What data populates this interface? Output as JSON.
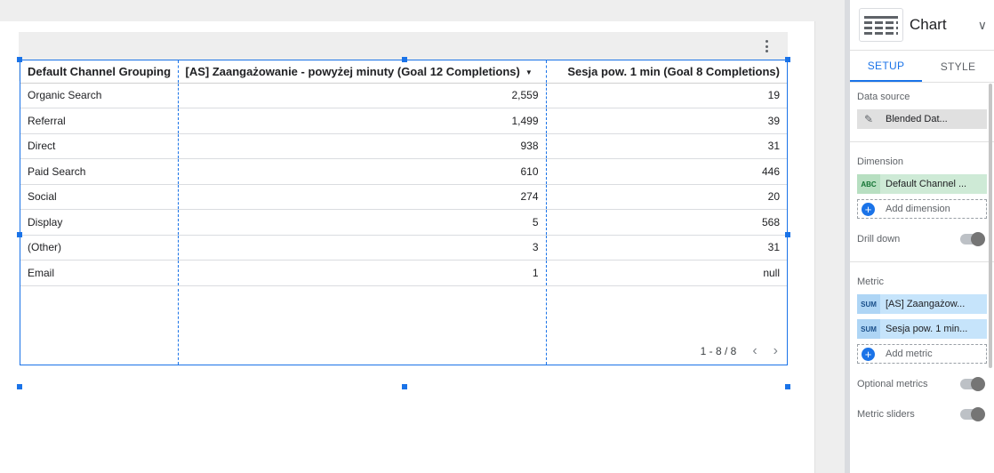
{
  "table": {
    "headers": [
      "Default Channel Grouping",
      "[AS] Zaangażowanie - powyżej minuty (Goal 12 Completions)",
      "Sesja pow. 1 min (Goal 8 Completions)"
    ],
    "rows": [
      [
        "Organic Search",
        "2,559",
        "19"
      ],
      [
        "Referral",
        "1,499",
        "39"
      ],
      [
        "Direct",
        "938",
        "31"
      ],
      [
        "Paid Search",
        "610",
        "446"
      ],
      [
        "Social",
        "274",
        "20"
      ],
      [
        "Display",
        "5",
        "568"
      ],
      [
        "(Other)",
        "3",
        "31"
      ],
      [
        "Email",
        "1",
        "null"
      ]
    ],
    "pager": "1 - 8 / 8",
    "sort_icon": "sort-desc-icon"
  },
  "panel": {
    "title": "Chart",
    "tabs": [
      "SETUP",
      "STYLE"
    ],
    "data_source_label": "Data source",
    "data_source_value": "Blended Dat...",
    "dimension_label": "Dimension",
    "dimension_tag": "ABC",
    "dimension_value": "Default Channel ...",
    "add_dimension": "Add dimension",
    "drill_down": "Drill down",
    "metric_label": "Metric",
    "metric_tag": "SUM",
    "metrics": [
      "[AS] Zaangażow...",
      "Sesja pow. 1 min..."
    ],
    "add_metric": "Add metric",
    "optional_metrics": "Optional metrics",
    "metric_sliders": "Metric sliders"
  },
  "colors": {
    "accent": "#1a73e8",
    "dimension_chip": "#ceead6",
    "metric_chip": "#c6e4fb"
  }
}
